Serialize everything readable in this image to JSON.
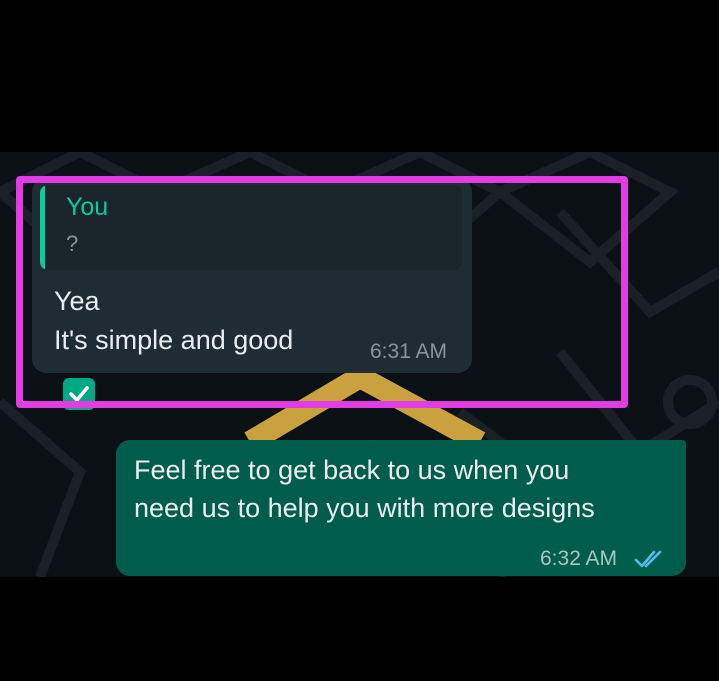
{
  "incoming_message": {
    "quoted_author": "You",
    "quoted_text": "?",
    "text": "Yea\nIt's simple and good",
    "time": "6:31 AM",
    "selected": true
  },
  "outgoing_message": {
    "text": "Feel free to get back to us when you need us to help you with more designs",
    "time": "6:32 AM",
    "status": "read"
  },
  "colors": {
    "highlight": "#e23ce6",
    "incoming_bubble": "#1f2c34",
    "outgoing_bubble": "#005c4b",
    "quote_accent": "#06cf9c",
    "read_ticks": "#53bdeb"
  }
}
